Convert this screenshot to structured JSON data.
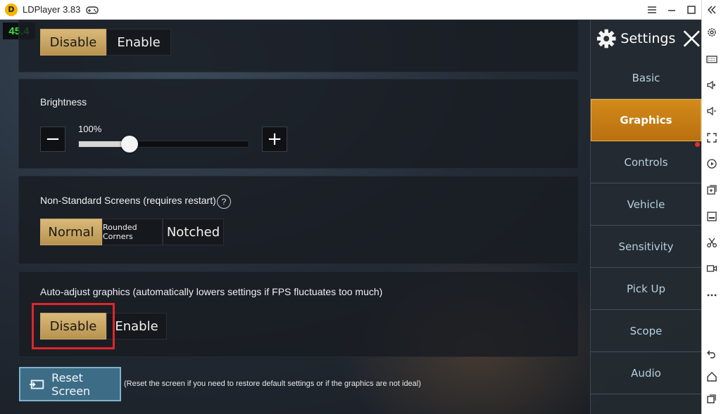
{
  "window": {
    "title": "LDPlayer 3.83",
    "logo_letter": "D"
  },
  "fps": "45.4",
  "panels": {
    "top_toggle": {
      "options": [
        "Disable",
        "Enable"
      ],
      "selected": "Disable"
    },
    "brightness": {
      "label": "Brightness",
      "value_text": "100%",
      "minus": "−",
      "plus": "+",
      "level_percent": 30
    },
    "screens": {
      "label": "Non-Standard Screens (requires restart)",
      "help": "?",
      "options": [
        "Normal",
        "Rounded Corners",
        "Notched"
      ],
      "selected": "Normal"
    },
    "auto_adjust": {
      "label": "Auto-adjust graphics (automatically lowers settings if FPS fluctuates too much)",
      "options": [
        "Disable",
        "Enable"
      ],
      "selected": "Disable"
    }
  },
  "reset": {
    "label": "Reset Screen",
    "note": "(Reset the screen if you need to restore default settings or if the graphics are not ideal)"
  },
  "menu": {
    "title": "Settings",
    "items": [
      "Basic",
      "Graphics",
      "Controls",
      "Vehicle",
      "Sensitivity",
      "Pick Up",
      "Scope",
      "Audio"
    ],
    "active": "Graphics"
  },
  "toolbar_icons": [
    "gear-icon",
    "keyboard-icon",
    "volume-up-icon",
    "volume-down-icon",
    "fullscreen-icon",
    "play-record-icon",
    "add-window-icon",
    "apk-install-icon",
    "scissors-icon",
    "video-record-icon",
    "more-icon",
    "back-icon",
    "home-icon",
    "recent-apps-icon"
  ],
  "colors": {
    "accent_gold": "#c9a65f",
    "menu_active": "#c97f16",
    "fps_green": "#38e03a",
    "highlight_red": "#e0262b",
    "reset_blue": "#3d6c86"
  }
}
